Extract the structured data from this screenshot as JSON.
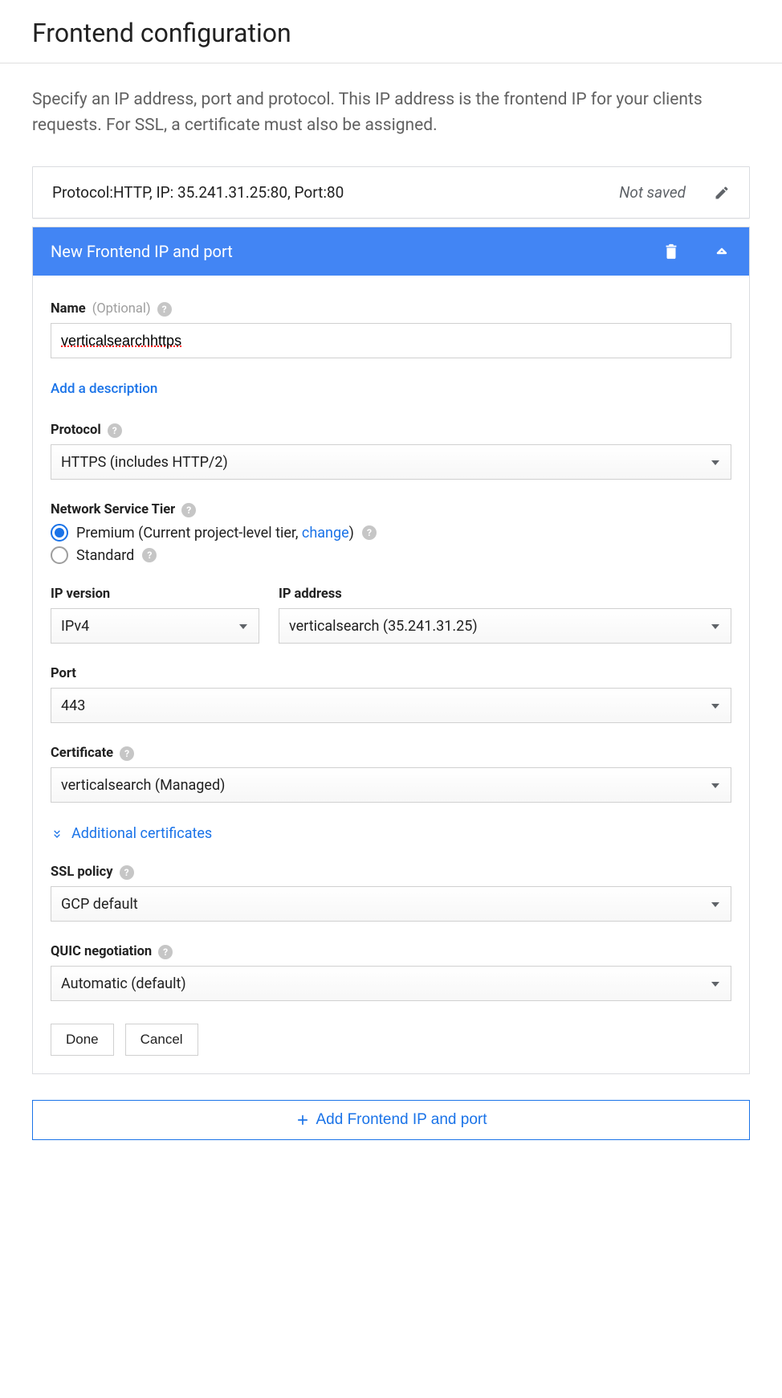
{
  "title": "Frontend configuration",
  "description": "Specify an IP address, port and protocol. This IP address is the frontend IP for your clients requests. For SSL, a certificate must also be assigned.",
  "saved_item": {
    "summary": "Protocol:HTTP, IP: 35.241.31.25:80, Port:80",
    "status": "Not saved"
  },
  "expand_header": {
    "title": "New Frontend IP and port"
  },
  "form": {
    "name_label": "Name",
    "name_optional": "(Optional)",
    "name_value": "verticalsearchhttps",
    "add_description": "Add a description",
    "protocol_label": "Protocol",
    "protocol_value": "HTTPS (includes HTTP/2)",
    "network_tier_label": "Network Service Tier",
    "premium_prefix": "Premium (Current project-level tier, ",
    "premium_change": "change",
    "premium_suffix": ")",
    "standard_label": "Standard",
    "ip_version_label": "IP version",
    "ip_version_value": "IPv4",
    "ip_address_label": "IP address",
    "ip_address_value": "verticalsearch (35.241.31.25)",
    "port_label": "Port",
    "port_value": "443",
    "certificate_label": "Certificate",
    "certificate_value": "verticalsearch (Managed)",
    "additional_certs": "Additional certificates",
    "ssl_policy_label": "SSL policy",
    "ssl_policy_value": "GCP default",
    "quic_label": "QUIC negotiation",
    "quic_value": "Automatic (default)",
    "done_label": "Done",
    "cancel_label": "Cancel"
  },
  "add_frontend_label": "Add Frontend IP and port"
}
